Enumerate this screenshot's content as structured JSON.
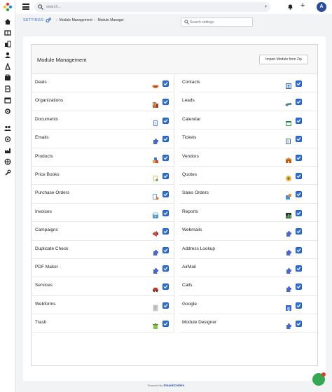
{
  "topbar": {
    "search_placeholder": "search...",
    "avatar_initial": "A"
  },
  "breadcrumb": {
    "root": "SETTINGS",
    "items": [
      "Module Management",
      "Module Manager"
    ]
  },
  "settings_search": {
    "placeholder": "Search settings"
  },
  "card": {
    "title": "Module Management",
    "import_button": "Import Module from Zip"
  },
  "modules_left": [
    {
      "label": "Deals",
      "icon": "handshake-icon",
      "enabled": true
    },
    {
      "label": "Organizations",
      "icon": "building-icon",
      "enabled": true
    },
    {
      "label": "Documents",
      "icon": "document-icon",
      "enabled": true
    },
    {
      "label": "Emails",
      "icon": "puzzle-icon",
      "enabled": true
    },
    {
      "label": "Products",
      "icon": "boxes-icon",
      "enabled": true
    },
    {
      "label": "Price Books",
      "icon": "price-book-icon",
      "enabled": true
    },
    {
      "label": "Purchase Orders",
      "icon": "purchase-order-icon",
      "enabled": true
    },
    {
      "label": "Invoices",
      "icon": "invoice-icon",
      "enabled": true
    },
    {
      "label": "Campaigns",
      "icon": "campaign-icon",
      "enabled": true
    },
    {
      "label": "Duplicate Check",
      "icon": "puzzle-icon",
      "enabled": true
    },
    {
      "label": "PDF Maker",
      "icon": "puzzle-icon",
      "enabled": true
    },
    {
      "label": "Services",
      "icon": "service-icon",
      "enabled": true
    },
    {
      "label": "Webforms",
      "icon": "form-icon",
      "enabled": true
    },
    {
      "label": "Trash",
      "icon": "trash-icon",
      "enabled": true
    }
  ],
  "modules_right": [
    {
      "label": "Contacts",
      "icon": "contact-card-icon",
      "enabled": true
    },
    {
      "label": "Leads",
      "icon": "leads-icon",
      "enabled": true
    },
    {
      "label": "Calendar",
      "icon": "calendar-icon",
      "enabled": true
    },
    {
      "label": "Tickets",
      "icon": "ticket-icon",
      "enabled": true
    },
    {
      "label": "Vendors",
      "icon": "vendor-icon",
      "enabled": true
    },
    {
      "label": "Quotes",
      "icon": "quote-icon",
      "enabled": true
    },
    {
      "label": "Sales Orders",
      "icon": "sales-order-icon",
      "enabled": true
    },
    {
      "label": "Reports",
      "icon": "report-icon",
      "enabled": true
    },
    {
      "label": "Webmails",
      "icon": "puzzle-icon",
      "enabled": true
    },
    {
      "label": "Address Lookup",
      "icon": "puzzle-icon",
      "enabled": true
    },
    {
      "label": "AirMail",
      "icon": "puzzle-icon",
      "enabled": true
    },
    {
      "label": "Calls",
      "icon": "puzzle-icon",
      "enabled": true
    },
    {
      "label": "Google",
      "icon": "google-icon",
      "enabled": true
    },
    {
      "label": "Module Designer",
      "icon": "puzzle-icon",
      "enabled": true
    }
  ],
  "footer": {
    "prefix": "Powered By",
    "brand": "SmackCoders"
  },
  "colors": {
    "accent": "#2f6fd6",
    "brand": "#2b4c9b",
    "chat": "#34a853"
  }
}
